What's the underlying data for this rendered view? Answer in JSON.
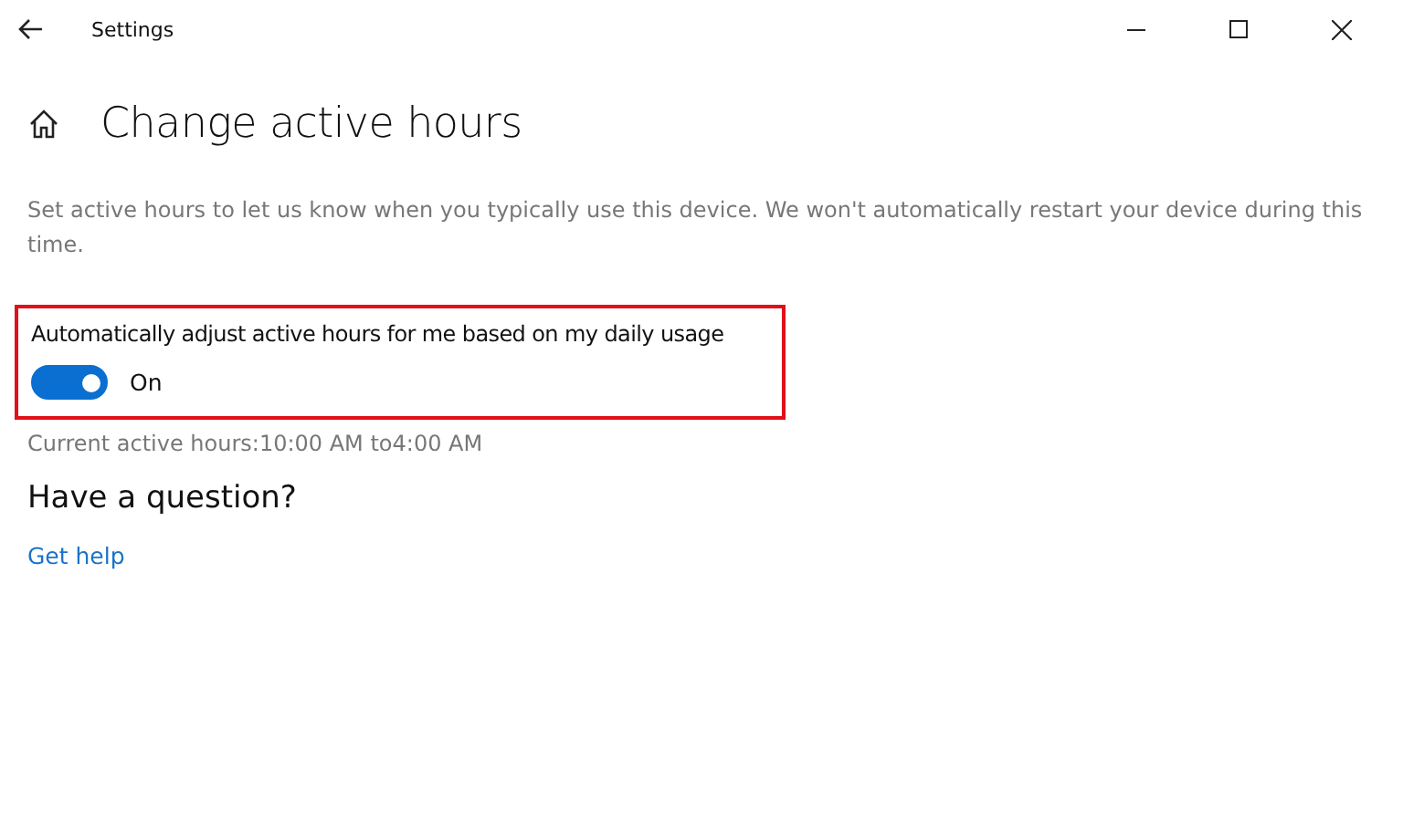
{
  "window": {
    "title": "Settings"
  },
  "page": {
    "title": "Change active hours",
    "description": "Set active hours to let us know when you typically use this device. We won't automatically restart your device during this time."
  },
  "setting": {
    "label": "Automatically adjust active hours for me based on my daily usage",
    "on": true,
    "state_text": "On",
    "highlighted": true
  },
  "current_hours": "Current active hours:10:00 AM to4:00 AM",
  "help": {
    "heading": "Have a question?",
    "link": "Get help"
  }
}
